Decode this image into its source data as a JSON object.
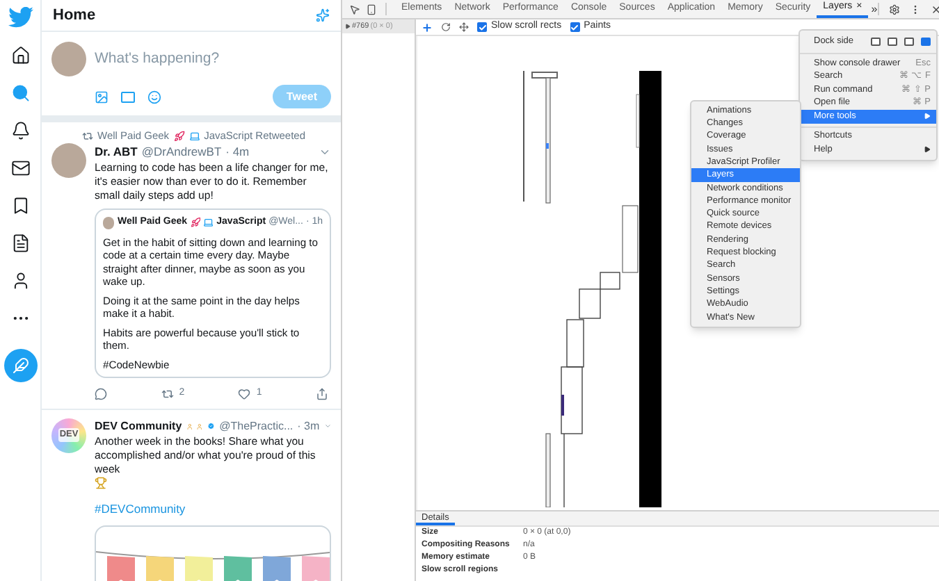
{
  "nav": [
    {
      "selected": false
    },
    {
      "selected": true
    },
    {
      "selected": false
    },
    {
      "selected": false
    },
    {
      "selected": false
    },
    {
      "selected": false
    },
    {
      "selected": false
    },
    {
      "selected": false
    },
    {
      "selected": false
    }
  ],
  "header": {
    "title": "Home"
  },
  "composer": {
    "placeholder": "What's happening?",
    "button": "Tweet",
    "disabled": true
  },
  "tweets": [
    {
      "retweeted_by": "Well Paid Geek",
      "retweeted_suffix": "JavaScript Retweeted",
      "name": "Dr. ABT",
      "handle": "@DrAndrewBT",
      "time": "· 4m",
      "text": "Learning to code has been a life changer for me, it's easier now than ever to do it. Remember small daily steps add up!",
      "quote": {
        "name": "Well Paid Geek",
        "name_suffix": "JavaScript",
        "handle": "@Wel...",
        "time": "· 1h",
        "paragraphs": [
          "Get in the habit of sitting down and learning to code at a certain time every day. Maybe straight after dinner, maybe as soon as you wake up.",
          "Doing it at the same point in the day helps make it a habit.",
          "Habits are powerful because you'll stick to them.",
          "#CodeNewbie"
        ]
      },
      "retweets": "2",
      "likes": "1"
    },
    {
      "avatar_text": "DEV",
      "name": "DEV Community",
      "verified": true,
      "handle": "@ThePractic...",
      "time": "· 3m",
      "text": "Another week in the books! Share what you accomplished and/or what you're proud of this week",
      "hashtag": "#DEVCommunity"
    }
  ],
  "devtools": {
    "tabs": [
      {
        "label": "Elements",
        "selected": false
      },
      {
        "label": "Network",
        "selected": false
      },
      {
        "label": "Performance",
        "selected": false
      },
      {
        "label": "Console",
        "selected": false
      },
      {
        "label": "Sources",
        "selected": false
      },
      {
        "label": "Application",
        "selected": false
      },
      {
        "label": "Memory",
        "selected": false
      },
      {
        "label": "Security",
        "selected": false
      },
      {
        "label": "Layers",
        "selected": true,
        "close": "×"
      }
    ],
    "overflow": "»",
    "tree": {
      "node": "#769",
      "size": "(0 × 0)"
    },
    "toggles": [
      {
        "label": "Slow scroll rects",
        "checked": true
      },
      {
        "label": "Paints",
        "checked": true
      }
    ],
    "menu": {
      "dock_label": "Dock side",
      "dock_options": [
        {
          "selected": false
        },
        {
          "selected": false
        },
        {
          "selected": false
        },
        {
          "selected": true
        }
      ],
      "groups": [
        [
          {
            "label": "Show console drawer",
            "shortcut": "Esc",
            "selected": false
          },
          {
            "label": "Search",
            "shortcut": "⌘ ⌥ F",
            "selected": false
          },
          {
            "label": "Run command",
            "shortcut": "⌘ ⇧ P",
            "selected": false
          },
          {
            "label": "Open file",
            "shortcut": "⌘ P",
            "selected": false
          },
          {
            "label": "More tools",
            "submenu": true,
            "selected": true
          }
        ],
        [
          {
            "label": "Shortcuts",
            "selected": false
          },
          {
            "label": "Help",
            "submenu": true,
            "selected": false
          }
        ]
      ]
    },
    "submenu": [
      {
        "label": "Animations",
        "selected": false
      },
      {
        "label": "Changes",
        "selected": false
      },
      {
        "label": "Coverage",
        "selected": false
      },
      {
        "label": "Issues",
        "selected": false
      },
      {
        "label": "JavaScript Profiler",
        "selected": false
      },
      {
        "label": "Layers",
        "selected": true
      },
      {
        "label": "Network conditions",
        "selected": false
      },
      {
        "label": "Performance monitor",
        "selected": false
      },
      {
        "label": "Quick source",
        "selected": false
      },
      {
        "label": "Remote devices",
        "selected": false
      },
      {
        "label": "Rendering",
        "selected": false
      },
      {
        "label": "Request blocking",
        "selected": false
      },
      {
        "label": "Search",
        "selected": false
      },
      {
        "label": "Sensors",
        "selected": false
      },
      {
        "label": "Settings",
        "selected": false
      },
      {
        "label": "WebAudio",
        "selected": false
      },
      {
        "label": "What's New",
        "selected": false
      }
    ],
    "details": {
      "tab": "Details",
      "rows": [
        {
          "label": "Size",
          "value": "0 × 0 (at 0,0)"
        },
        {
          "label": "Compositing Reasons",
          "value": "n/a"
        },
        {
          "label": "Memory estimate",
          "value": "0 B"
        },
        {
          "label": "Slow scroll regions"
        }
      ]
    }
  }
}
